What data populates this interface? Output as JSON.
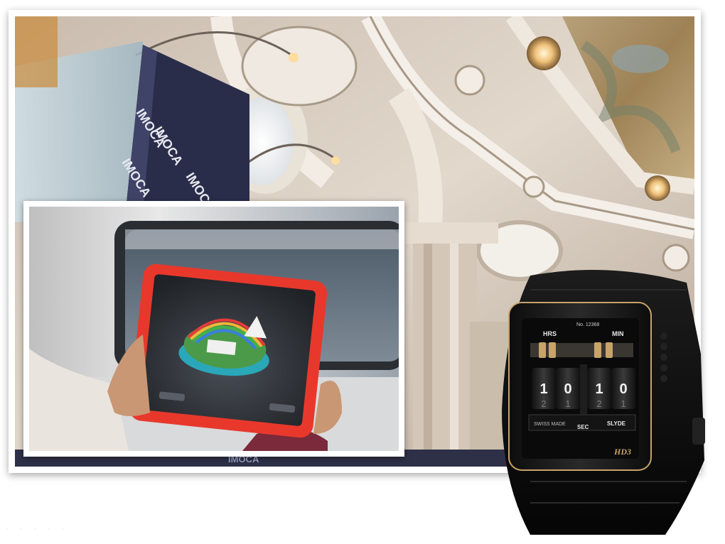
{
  "main_photo": {
    "banner_text": [
      "IMOCA",
      "IMOCA",
      "IMOCA",
      "IMOCA"
    ],
    "bottom_strip_text": "IMOCA",
    "colors": {
      "ceiling": "#d9ccc0",
      "banner": "#2a2d4a",
      "fresco": "#b89a6a"
    }
  },
  "inset_photo": {
    "device": "tablet",
    "colors": {
      "case": "#e8382c",
      "screen": "#2b2e33",
      "sky": "#6b7b8c"
    }
  },
  "watch": {
    "serial": "No. 12368",
    "label_hours": "HRS",
    "label_minutes": "MIN",
    "label_seconds": "SEC",
    "label_swiss": "SWISS MADE",
    "label_brand": "SLYDE",
    "logo": "HD3",
    "hour_digits": [
      "1",
      "0"
    ],
    "minute_digits": [
      "1",
      "0"
    ],
    "hour_digits_below": [
      "2",
      "1"
    ],
    "minute_digits_below": [
      "2",
      "1"
    ],
    "colors": {
      "case": "#151515",
      "accent": "#c8a36a"
    }
  }
}
